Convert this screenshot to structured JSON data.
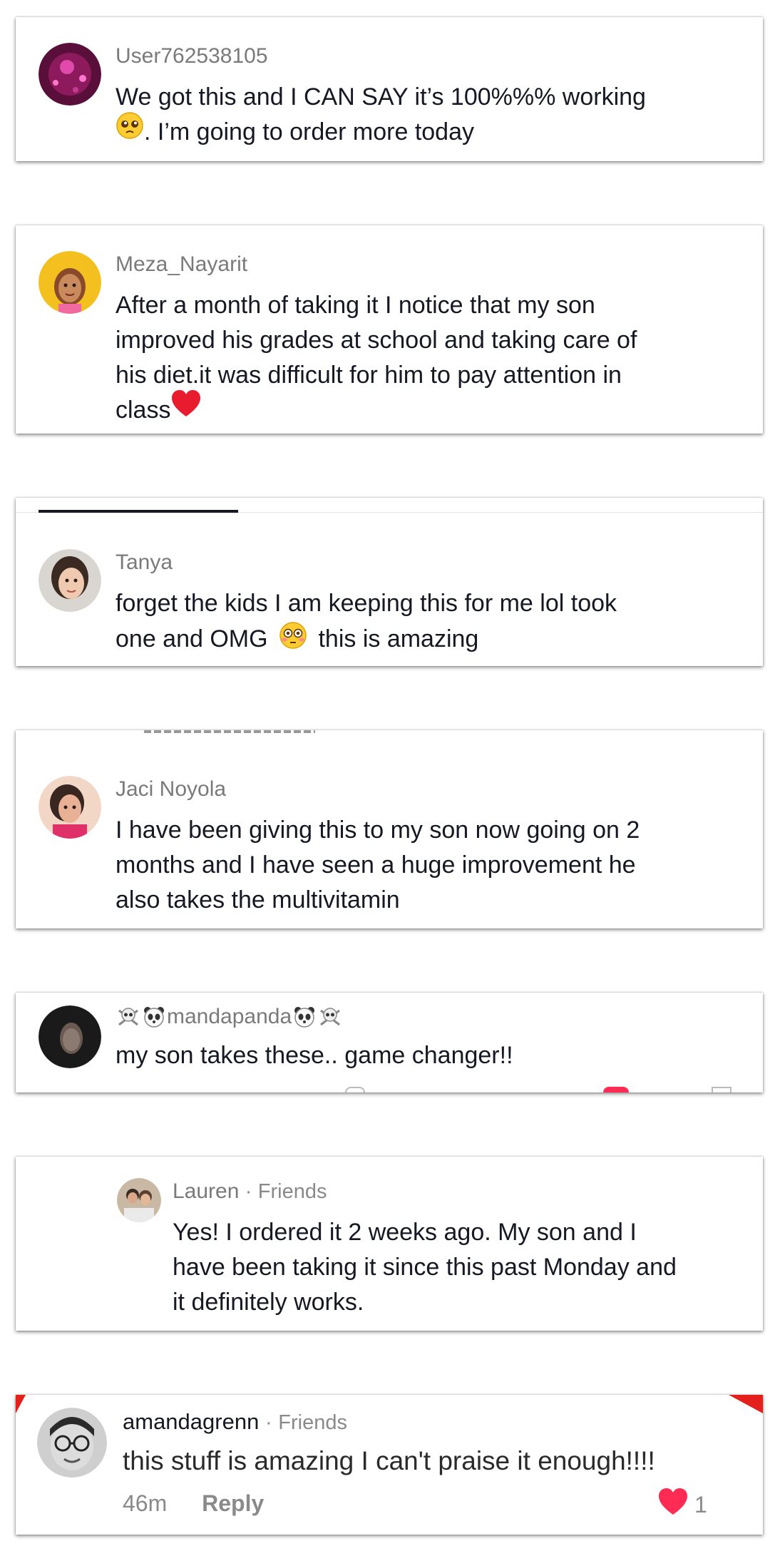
{
  "comments": [
    {
      "username": "User762538105",
      "text_line1": "We got this and I CAN SAY it’s 100%%% working",
      "text_line2": ". I’m going to order more today",
      "emoji": "pleading-face"
    },
    {
      "username": "Meza_Nayarit",
      "lines": [
        "After a month of taking it I notice that my son",
        "improved his grades at school and taking care of",
        "his diet.it was difficult for him to pay attention in",
        "class"
      ],
      "emoji": "red-heart"
    },
    {
      "username": "Tanya",
      "line1": "forget the kids I am keeping this for me lol took",
      "line2_a": "one and OMG",
      "line2_b": "this is amazing",
      "emoji": "flushed-face"
    },
    {
      "username": "Jaci Noyola",
      "lines": [
        "I have been giving this to my son now going on 2",
        "months and I have seen a huge improvement he",
        "also takes the multivitamin"
      ]
    },
    {
      "username": "mandapanda",
      "text": "my son takes these.. game changer!!",
      "emoji_left": [
        "skull-crossbones",
        "panda"
      ],
      "emoji_right": [
        "panda",
        "skull-crossbones"
      ]
    },
    {
      "username": "Lauren",
      "tag": "Friends",
      "separator": "·",
      "lines": [
        "Yes! I ordered it 2 weeks ago. My son and I",
        "have been taking it since this past Monday and",
        "it definitely works."
      ]
    },
    {
      "username": "amandagrenn",
      "tag": "Friends",
      "separator": "·",
      "text": "this stuff is amazing I can't praise it enough!!!!",
      "time": "46m",
      "reply_label": "Reply",
      "like_count": "1",
      "like_icon_color": "#fe2c55"
    }
  ],
  "colors": {
    "text": "#161823",
    "username": "#7a7a7a",
    "like": "#fe2c55"
  }
}
